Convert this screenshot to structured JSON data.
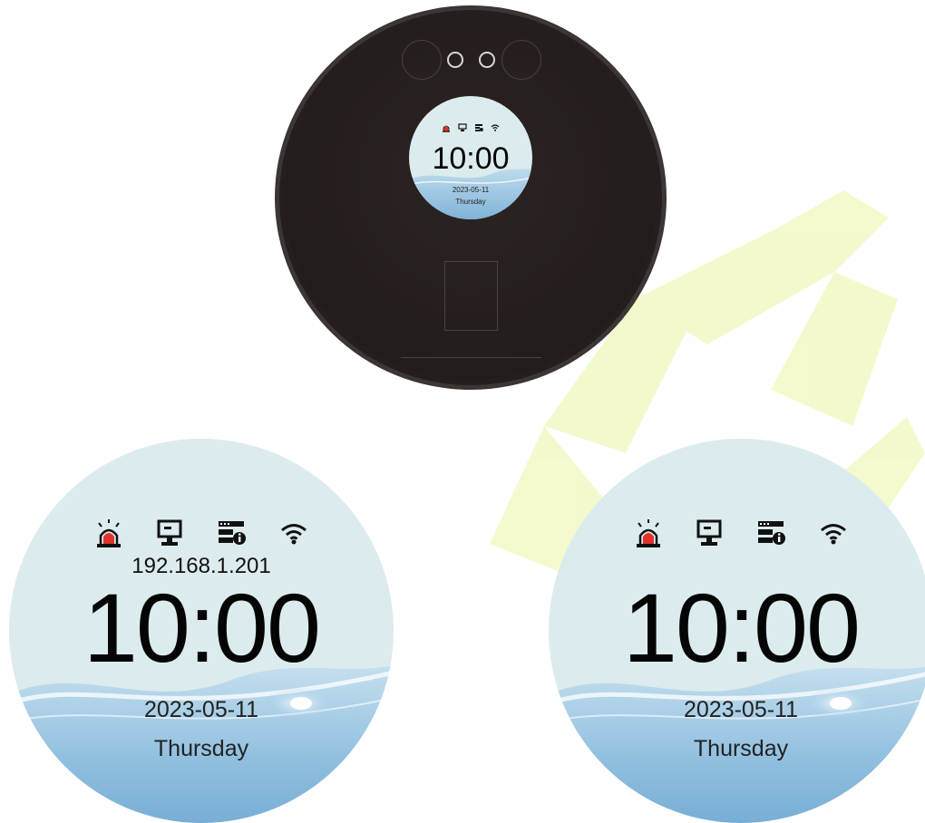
{
  "device_screen": {
    "time": "10:00",
    "date": "2023-05-11",
    "weekday": "Thursday"
  },
  "screen_with_ip": {
    "ip_address": "192.168.1.201",
    "time": "10:00",
    "date": "2023-05-11",
    "weekday": "Thursday"
  },
  "screen_without_ip": {
    "time": "10:00",
    "date": "2023-05-11",
    "weekday": "Thursday"
  },
  "status_icons": [
    "alarm-icon",
    "monitor-icon",
    "server-info-icon",
    "wifi-icon"
  ],
  "colors": {
    "screen_bg": "#dcebee",
    "device_body": "#221c1a",
    "alarm_red": "#e0312a",
    "watermark": "#f3f9c8"
  }
}
